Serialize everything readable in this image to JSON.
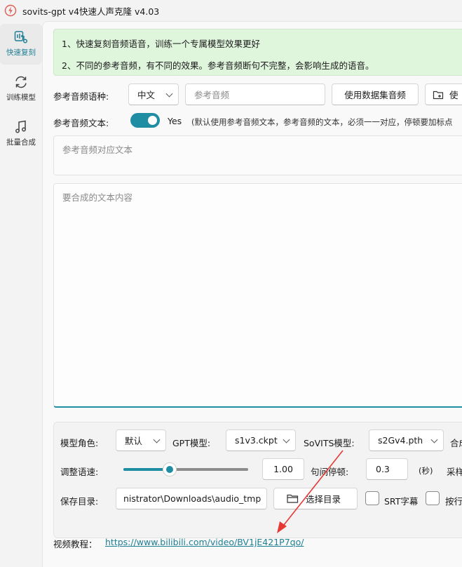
{
  "window": {
    "title": "sovits-gpt v4快速人声克隆 v4.03"
  },
  "sidebar": {
    "items": [
      {
        "label": "快速复刻",
        "icon": "voice-clone-icon",
        "active": true
      },
      {
        "label": "训练模型",
        "icon": "refresh-icon",
        "active": false
      },
      {
        "label": "批量合成",
        "icon": "music-note-icon",
        "active": false
      }
    ]
  },
  "info": {
    "line1": "1、快速复刻音频语音，训练一个专属模型效果更好",
    "line2": "2、不同的参考音频，有不同的效果。参考音频断句不完整，会影响生成的语音。"
  },
  "reference": {
    "lang_label": "参考音频语种:",
    "lang_value": "中文",
    "audio_placeholder": "参考音频",
    "dataset_button": "使用数据集音频",
    "use_button": "使"
  },
  "ref_text": {
    "label": "参考音频文本:",
    "toggle_state": "Yes",
    "hint": "(默认使用参考音频文本，参考音频的文本，必须一一对应，停顿要加标点",
    "placeholder": "参考音频对应文本"
  },
  "synth_text": {
    "placeholder": "要合成的文本内容"
  },
  "model": {
    "role_label": "模型角色:",
    "role_value": "默认",
    "gpt_label": "GPT模型:",
    "gpt_value": "s1v3.ckpt",
    "sovits_label": "SoVITS模型:",
    "sovits_value": "s2Gv4.pth",
    "extra_label": "合成"
  },
  "speed": {
    "label": "调整语速:",
    "value": "1.00",
    "level": 0.37,
    "pause_label": "句间停顿:",
    "pause_value": "0.3",
    "pause_unit": "(秒)",
    "extra_label": "采样"
  },
  "output": {
    "dir_label": "保存目录:",
    "dir_value": "nistrator\\Downloads\\audio_tmp",
    "choose_dir_button": "选择目录",
    "srt_label": "SRT字幕",
    "by_line_label": "按行"
  },
  "tutorial": {
    "label": "视频教程：",
    "url": "https://www.bilibili.com/video/BV1jE421P7qo/"
  },
  "colors": {
    "accent": "#1f8ea3",
    "info_bg": "#dff6dd",
    "arrow": "#e53935"
  }
}
